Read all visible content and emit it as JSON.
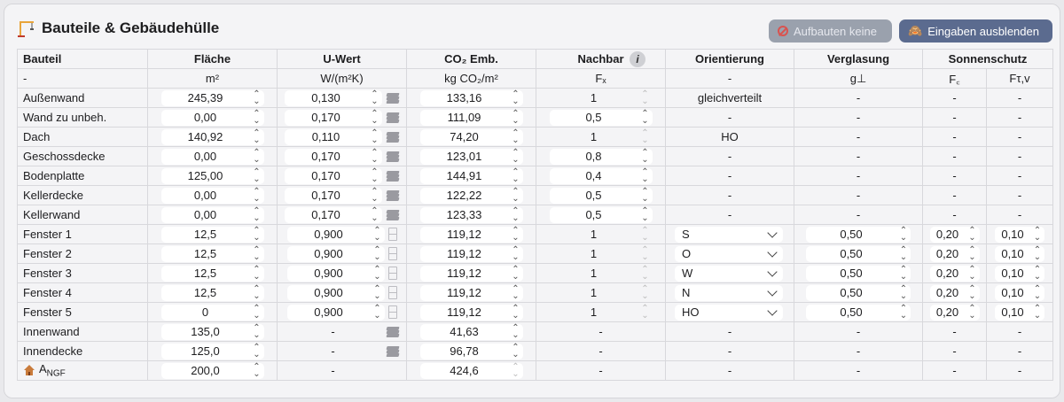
{
  "title": "Bauteile & Gebäudehülle",
  "buttons": {
    "aufbauten": "Aufbauten keine",
    "eingaben": "Eingaben ausblenden"
  },
  "headers": [
    "Bauteil",
    "Fläche",
    "U-Wert",
    "CO₂ Emb.",
    "Nachbar",
    "Orientierung",
    "Verglasung",
    "Sonnenschutz"
  ],
  "units": {
    "bauteil": "-",
    "flaeche": "m²",
    "uwert": "W/(m²K)",
    "co2": "kg CO₂/m²",
    "nachbar": "Fₓ",
    "orient": "-",
    "vergl": "g⊥",
    "fc": "F꜀",
    "ftv": "Fτ,v"
  },
  "rows": [
    {
      "name": "Außenwand",
      "area": "245,39",
      "u": "0,130",
      "uicon": "layers",
      "co2": "133,16",
      "fx": "1",
      "fxField": false,
      "orient": "gleichverteilt",
      "orientSel": false,
      "g": "-",
      "fc": "-",
      "ftv": "-"
    },
    {
      "name": "Wand zu unbeh.",
      "area": "0,00",
      "u": "0,170",
      "uicon": "layers",
      "co2": "111,09",
      "fx": "0,5",
      "fxField": true,
      "orient": "-",
      "orientSel": false,
      "g": "-",
      "fc": "-",
      "ftv": "-"
    },
    {
      "name": "Dach",
      "area": "140,92",
      "u": "0,110",
      "uicon": "layers",
      "co2": "74,20",
      "fx": "1",
      "fxField": false,
      "orient": "HO",
      "orientSel": false,
      "g": "-",
      "fc": "-",
      "ftv": "-"
    },
    {
      "name": "Geschossdecke",
      "area": "0,00",
      "u": "0,170",
      "uicon": "layers",
      "co2": "123,01",
      "fx": "0,8",
      "fxField": true,
      "orient": "-",
      "orientSel": false,
      "g": "-",
      "fc": "-",
      "ftv": "-"
    },
    {
      "name": "Bodenplatte",
      "area": "125,00",
      "u": "0,170",
      "uicon": "layers",
      "co2": "144,91",
      "fx": "0,4",
      "fxField": true,
      "orient": "-",
      "orientSel": false,
      "g": "-",
      "fc": "-",
      "ftv": "-"
    },
    {
      "name": "Kellerdecke",
      "area": "0,00",
      "u": "0,170",
      "uicon": "layers",
      "co2": "122,22",
      "fx": "0,5",
      "fxField": true,
      "orient": "-",
      "orientSel": false,
      "g": "-",
      "fc": "-",
      "ftv": "-"
    },
    {
      "name": "Kellerwand",
      "area": "0,00",
      "u": "0,170",
      "uicon": "layers",
      "co2": "123,33",
      "fx": "0,5",
      "fxField": true,
      "orient": "-",
      "orientSel": false,
      "g": "-",
      "fc": "-",
      "ftv": "-"
    },
    {
      "name": "Fenster 1",
      "area": "12,5",
      "u": "0,900",
      "uicon": "window",
      "co2": "119,12",
      "fx": "1",
      "fxField": false,
      "orient": "S",
      "orientSel": true,
      "g": "0,50",
      "fc": "0,20",
      "ftv": "0,10"
    },
    {
      "name": "Fenster 2",
      "area": "12,5",
      "u": "0,900",
      "uicon": "window",
      "co2": "119,12",
      "fx": "1",
      "fxField": false,
      "orient": "O",
      "orientSel": true,
      "g": "0,50",
      "fc": "0,20",
      "ftv": "0,10"
    },
    {
      "name": "Fenster 3",
      "area": "12,5",
      "u": "0,900",
      "uicon": "window",
      "co2": "119,12",
      "fx": "1",
      "fxField": false,
      "orient": "W",
      "orientSel": true,
      "g": "0,50",
      "fc": "0,20",
      "ftv": "0,10"
    },
    {
      "name": "Fenster 4",
      "area": "12,5",
      "u": "0,900",
      "uicon": "window",
      "co2": "119,12",
      "fx": "1",
      "fxField": false,
      "orient": "N",
      "orientSel": true,
      "g": "0,50",
      "fc": "0,20",
      "ftv": "0,10"
    },
    {
      "name": "Fenster 5",
      "area": "0",
      "u": "0,900",
      "uicon": "window",
      "co2": "119,12",
      "fx": "1",
      "fxField": false,
      "orient": "HO",
      "orientSel": true,
      "g": "0,50",
      "fc": "0,20",
      "ftv": "0,10"
    },
    {
      "name": "Innenwand",
      "area": "135,0",
      "u": "-",
      "uicon": "layers",
      "co2": "41,63",
      "fx": "-",
      "fxField": false,
      "orient": "-",
      "orientSel": false,
      "g": "-",
      "fc": "-",
      "ftv": "-"
    },
    {
      "name": "Innendecke",
      "area": "125,0",
      "u": "-",
      "uicon": "layers",
      "co2": "96,78",
      "fx": "-",
      "fxField": false,
      "orient": "-",
      "orientSel": false,
      "g": "-",
      "fc": "-",
      "ftv": "-"
    },
    {
      "name": "ANGF",
      "area": "200,0",
      "u": "-",
      "uicon": "none",
      "co2": "424,6",
      "fx": "-",
      "fxField": false,
      "orient": "-",
      "orientSel": false,
      "g": "-",
      "fc": "-",
      "ftv": "-"
    }
  ]
}
